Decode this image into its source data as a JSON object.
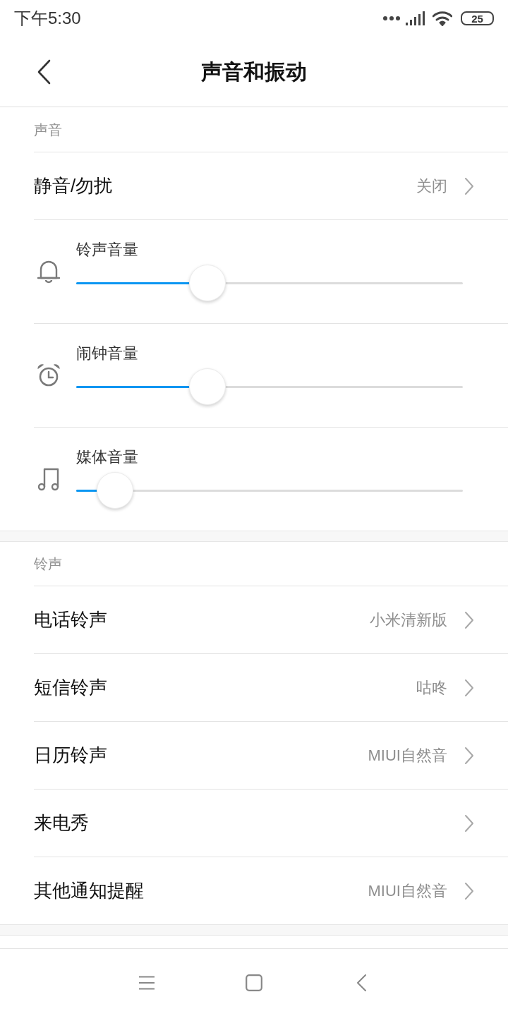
{
  "status_bar": {
    "time": "下午5:30",
    "battery": "25"
  },
  "header": {
    "title": "声音和振动"
  },
  "sections": [
    {
      "title": "声音",
      "items": [
        {
          "kind": "link",
          "label": "静音/勿扰",
          "value": "关闭"
        },
        {
          "kind": "slider",
          "label": "铃声音量",
          "level": 0.34
        },
        {
          "kind": "slider",
          "label": "闹钟音量",
          "level": 0.34
        },
        {
          "kind": "slider",
          "label": "媒体音量",
          "level": 0.1
        }
      ]
    },
    {
      "title": "铃声",
      "items": [
        {
          "kind": "link",
          "label": "电话铃声",
          "value": "小米清新版"
        },
        {
          "kind": "link",
          "label": "短信铃声",
          "value": "咕咚"
        },
        {
          "kind": "link",
          "label": "日历铃声",
          "value": "MIUI自然音"
        },
        {
          "kind": "link",
          "label": "来电秀"
        },
        {
          "kind": "link",
          "label": "其他通知提醒",
          "value": "MIUI自然音"
        }
      ]
    }
  ]
}
